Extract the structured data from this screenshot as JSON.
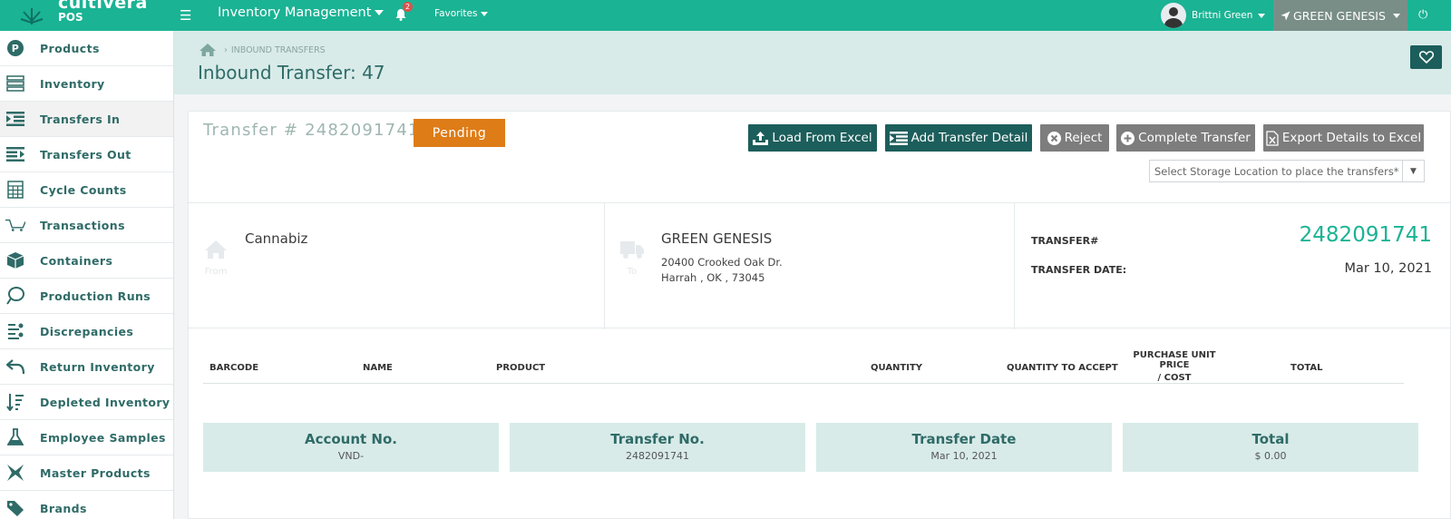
{
  "topbar": {
    "logo_line1": "cultivera",
    "logo_line2": "POS",
    "module": "Inventory Management",
    "notification_count": "2",
    "favorites": "Favorites",
    "user_name": "Brittni Green",
    "location": "GREEN GENESIS"
  },
  "sidebar": {
    "items": [
      {
        "label": "Products",
        "icon": "products-icon"
      },
      {
        "label": "Inventory",
        "icon": "inventory-icon"
      },
      {
        "label": "Transfers In",
        "icon": "transfers-in-icon"
      },
      {
        "label": "Transfers Out",
        "icon": "transfers-out-icon"
      },
      {
        "label": "Cycle Counts",
        "icon": "calculator-icon"
      },
      {
        "label": "Transactions",
        "icon": "cart-icon"
      },
      {
        "label": "Containers",
        "icon": "box-icon"
      },
      {
        "label": "Production Runs",
        "icon": "production-icon"
      },
      {
        "label": "Discrepancies",
        "icon": "discrepancies-icon"
      },
      {
        "label": "Return Inventory",
        "icon": "return-icon"
      },
      {
        "label": "Depleted Inventory",
        "icon": "depleted-icon"
      },
      {
        "label": "Employee Samples",
        "icon": "flask-icon"
      },
      {
        "label": "Master Products",
        "icon": "master-products-icon"
      },
      {
        "label": "Brands",
        "icon": "tag-icon"
      }
    ]
  },
  "header": {
    "breadcrumb": "INBOUND TRANSFERS",
    "title": "Inbound Transfer: 47"
  },
  "transfer": {
    "label": "Transfer # 2482091741",
    "status": "Pending"
  },
  "actions": {
    "load_excel": "Load From Excel",
    "add_detail": "Add Transfer Detail",
    "reject": "Reject",
    "complete": "Complete Transfer",
    "export": "Export Details to Excel"
  },
  "storage_select": {
    "placeholder": "Select Storage Location to place the transfers*"
  },
  "from": {
    "caption": "From",
    "name": "Cannabiz"
  },
  "to": {
    "caption": "To",
    "name": "GREEN GENESIS",
    "address_line1": "20400 Crooked Oak Dr.",
    "address_line2": "Harrah , OK , 73045"
  },
  "meta": {
    "transfer_label": "TRANSFER#",
    "transfer_number": "2482091741",
    "date_label": "TRANSFER DATE:",
    "date_value": "Mar 10, 2021"
  },
  "table": {
    "columns": [
      "BARCODE",
      "NAME",
      "PRODUCT",
      "QUANTITY",
      "QUANTITY TO ACCEPT",
      "PURCHASE UNIT PRICE",
      "/ COST",
      "TOTAL"
    ]
  },
  "summary": [
    {
      "title": "Account No.",
      "value": "VND-"
    },
    {
      "title": "Transfer No.",
      "value": "2482091741"
    },
    {
      "title": "Transfer Date",
      "value": "Mar 10, 2021"
    },
    {
      "title": "Total",
      "value": "$ 0.00"
    }
  ],
  "colors": {
    "brand_green": "#1ab394",
    "dark_teal": "#1c5e5b",
    "pending_orange": "#de7c18",
    "panel_tint": "#d8ebe9"
  }
}
